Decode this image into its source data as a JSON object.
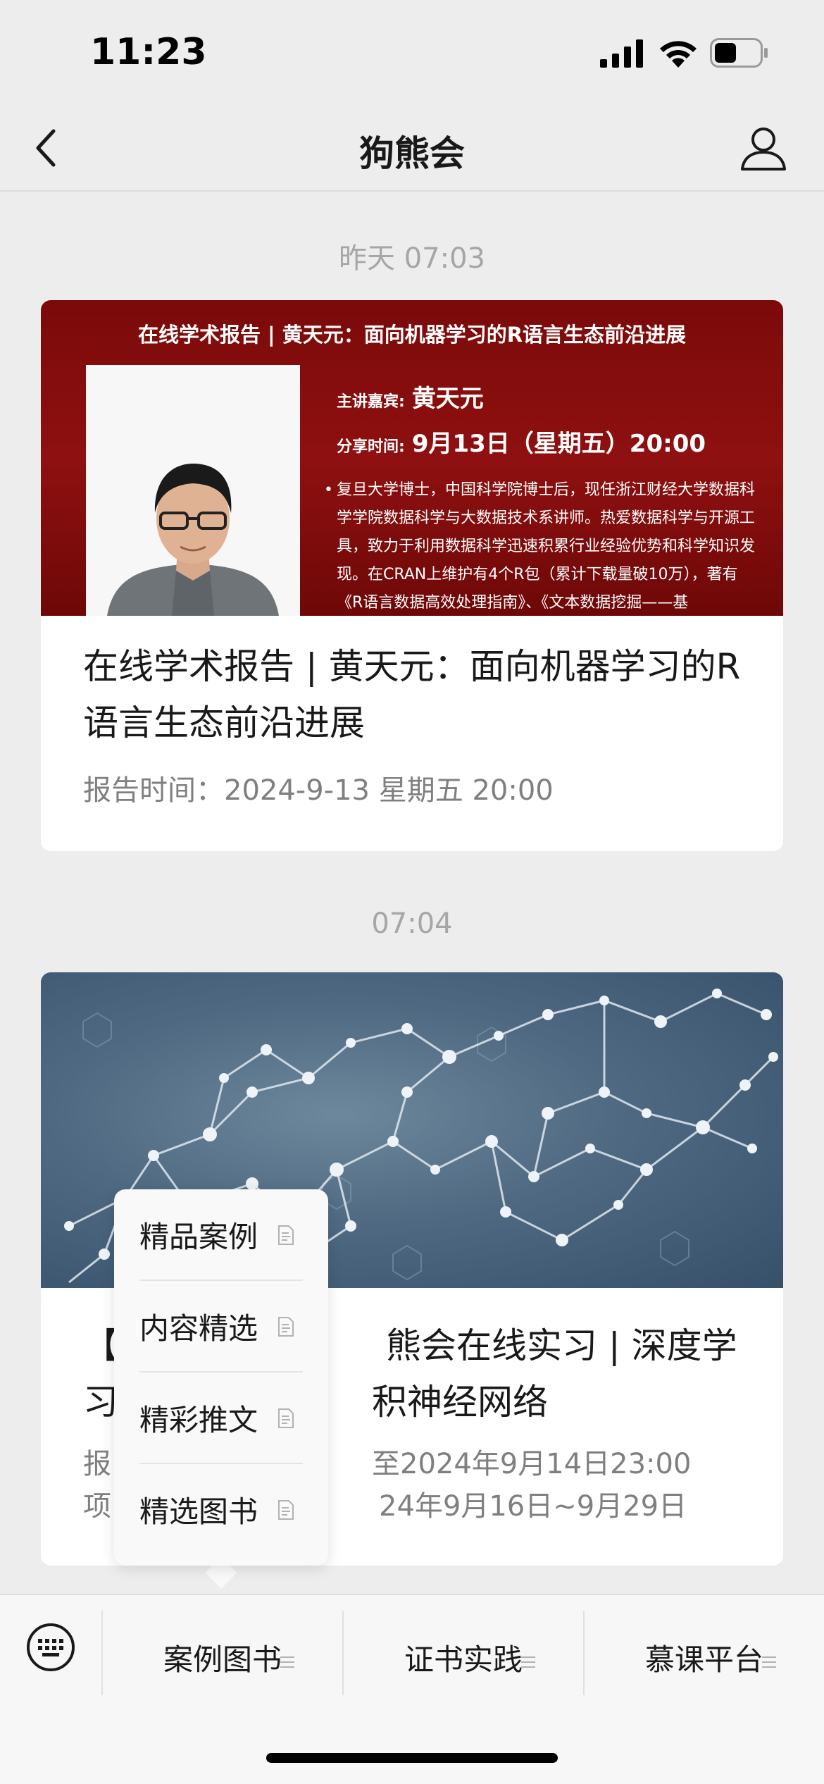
{
  "status_bar": {
    "time": "11:23"
  },
  "nav": {
    "title": "狗熊会"
  },
  "messages": [
    {
      "timestamp": "昨天 07:03",
      "banner": {
        "title": "在线学术报告 | 黄天元：面向机器学习的R语言生态前沿进展",
        "speaker_label": "主讲嘉宾:",
        "speaker": "黄天元",
        "time_label": "分享时间:",
        "time": "9月13日（星期五）20:00",
        "bio": "复旦大学博士，中国科学院博士后，现任浙江财经大学数据科学学院数据科学与大数据技术系讲师。热爱数据科学与开源工具，致力于利用数据科学迅速积累行业经验优势和科学知识发现。在CRAN上维护有4个R包（累计下载量破10万），著有《R语言数据高效处理指南》、《文本数据挖掘——基"
      },
      "title": "在线学术报告 | 黄天元：面向机器学习的R语言生态前沿进展",
      "desc": "报告时间：2024-9-13 星期五 20:00"
    },
    {
      "timestamp": "07:04",
      "title_left": "【最",
      "title_right": "熊会在线实习 | 深度学",
      "title2_left": "习",
      "title2_right": "积神经网络",
      "desc1_left": "报",
      "desc1_right": "至2024年9月14日23:00",
      "desc2_left": "项",
      "desc2_right": "24年9月16日~9月29日"
    }
  ],
  "popup_menu": {
    "items": [
      {
        "label": "精品案例"
      },
      {
        "label": "内容精选"
      },
      {
        "label": "精彩推文"
      },
      {
        "label": "精选图书"
      }
    ]
  },
  "bottom_menu": {
    "tabs": [
      {
        "label": "案例图书"
      },
      {
        "label": "证书实践"
      },
      {
        "label": "慕课平台"
      }
    ]
  },
  "colors": {
    "background": "#ededed",
    "card": "#ffffff",
    "banner_red": "#7b0a0a",
    "muted_text": "#7f7f7f"
  }
}
